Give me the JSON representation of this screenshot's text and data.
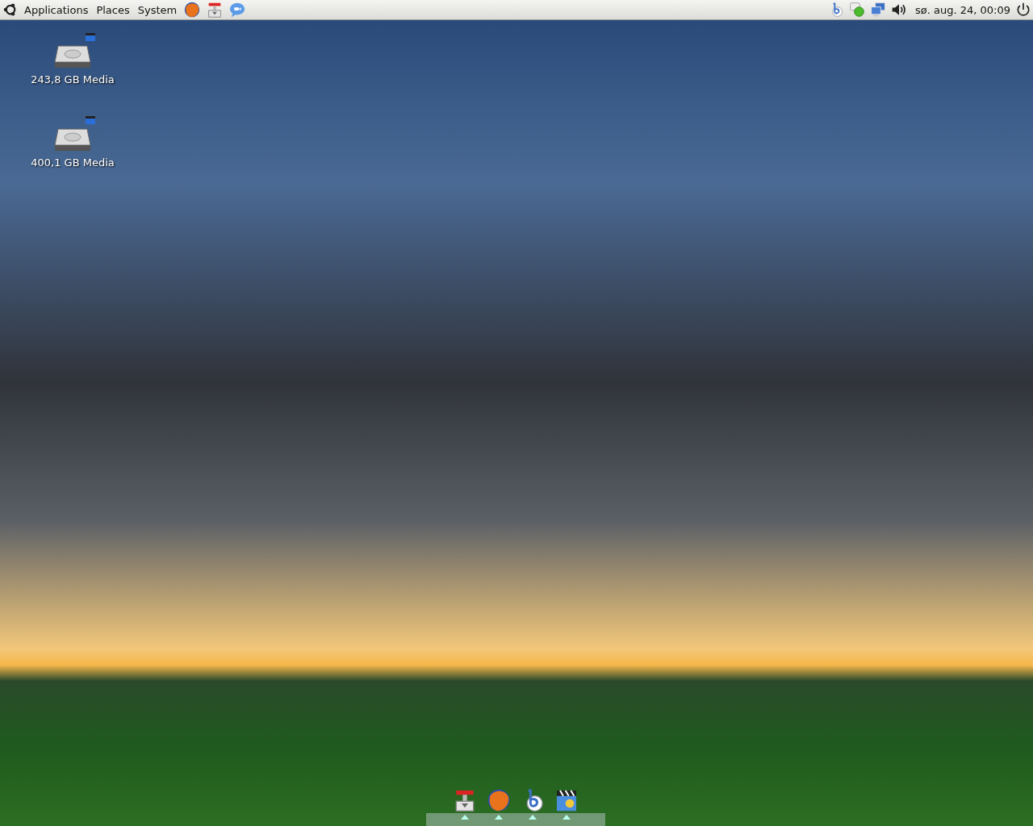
{
  "top_panel": {
    "menus": [
      "Applications",
      "Places",
      "System"
    ],
    "launchers": [
      {
        "kind": "browser"
      },
      {
        "kind": "installer"
      },
      {
        "kind": "chat"
      }
    ],
    "tray": [
      {
        "kind": "bluetooth"
      },
      {
        "kind": "status"
      },
      {
        "kind": "network"
      },
      {
        "kind": "volume"
      }
    ],
    "clock": "sø. aug. 24, 00:09"
  },
  "desktop_icons": [
    {
      "label": "243,8 GB Media"
    },
    {
      "label": "400,1 GB Media"
    }
  ],
  "dock": [
    {
      "kind": "installer",
      "running": true
    },
    {
      "kind": "browser",
      "running": true
    },
    {
      "kind": "music",
      "running": true
    },
    {
      "kind": "video",
      "running": true
    }
  ]
}
